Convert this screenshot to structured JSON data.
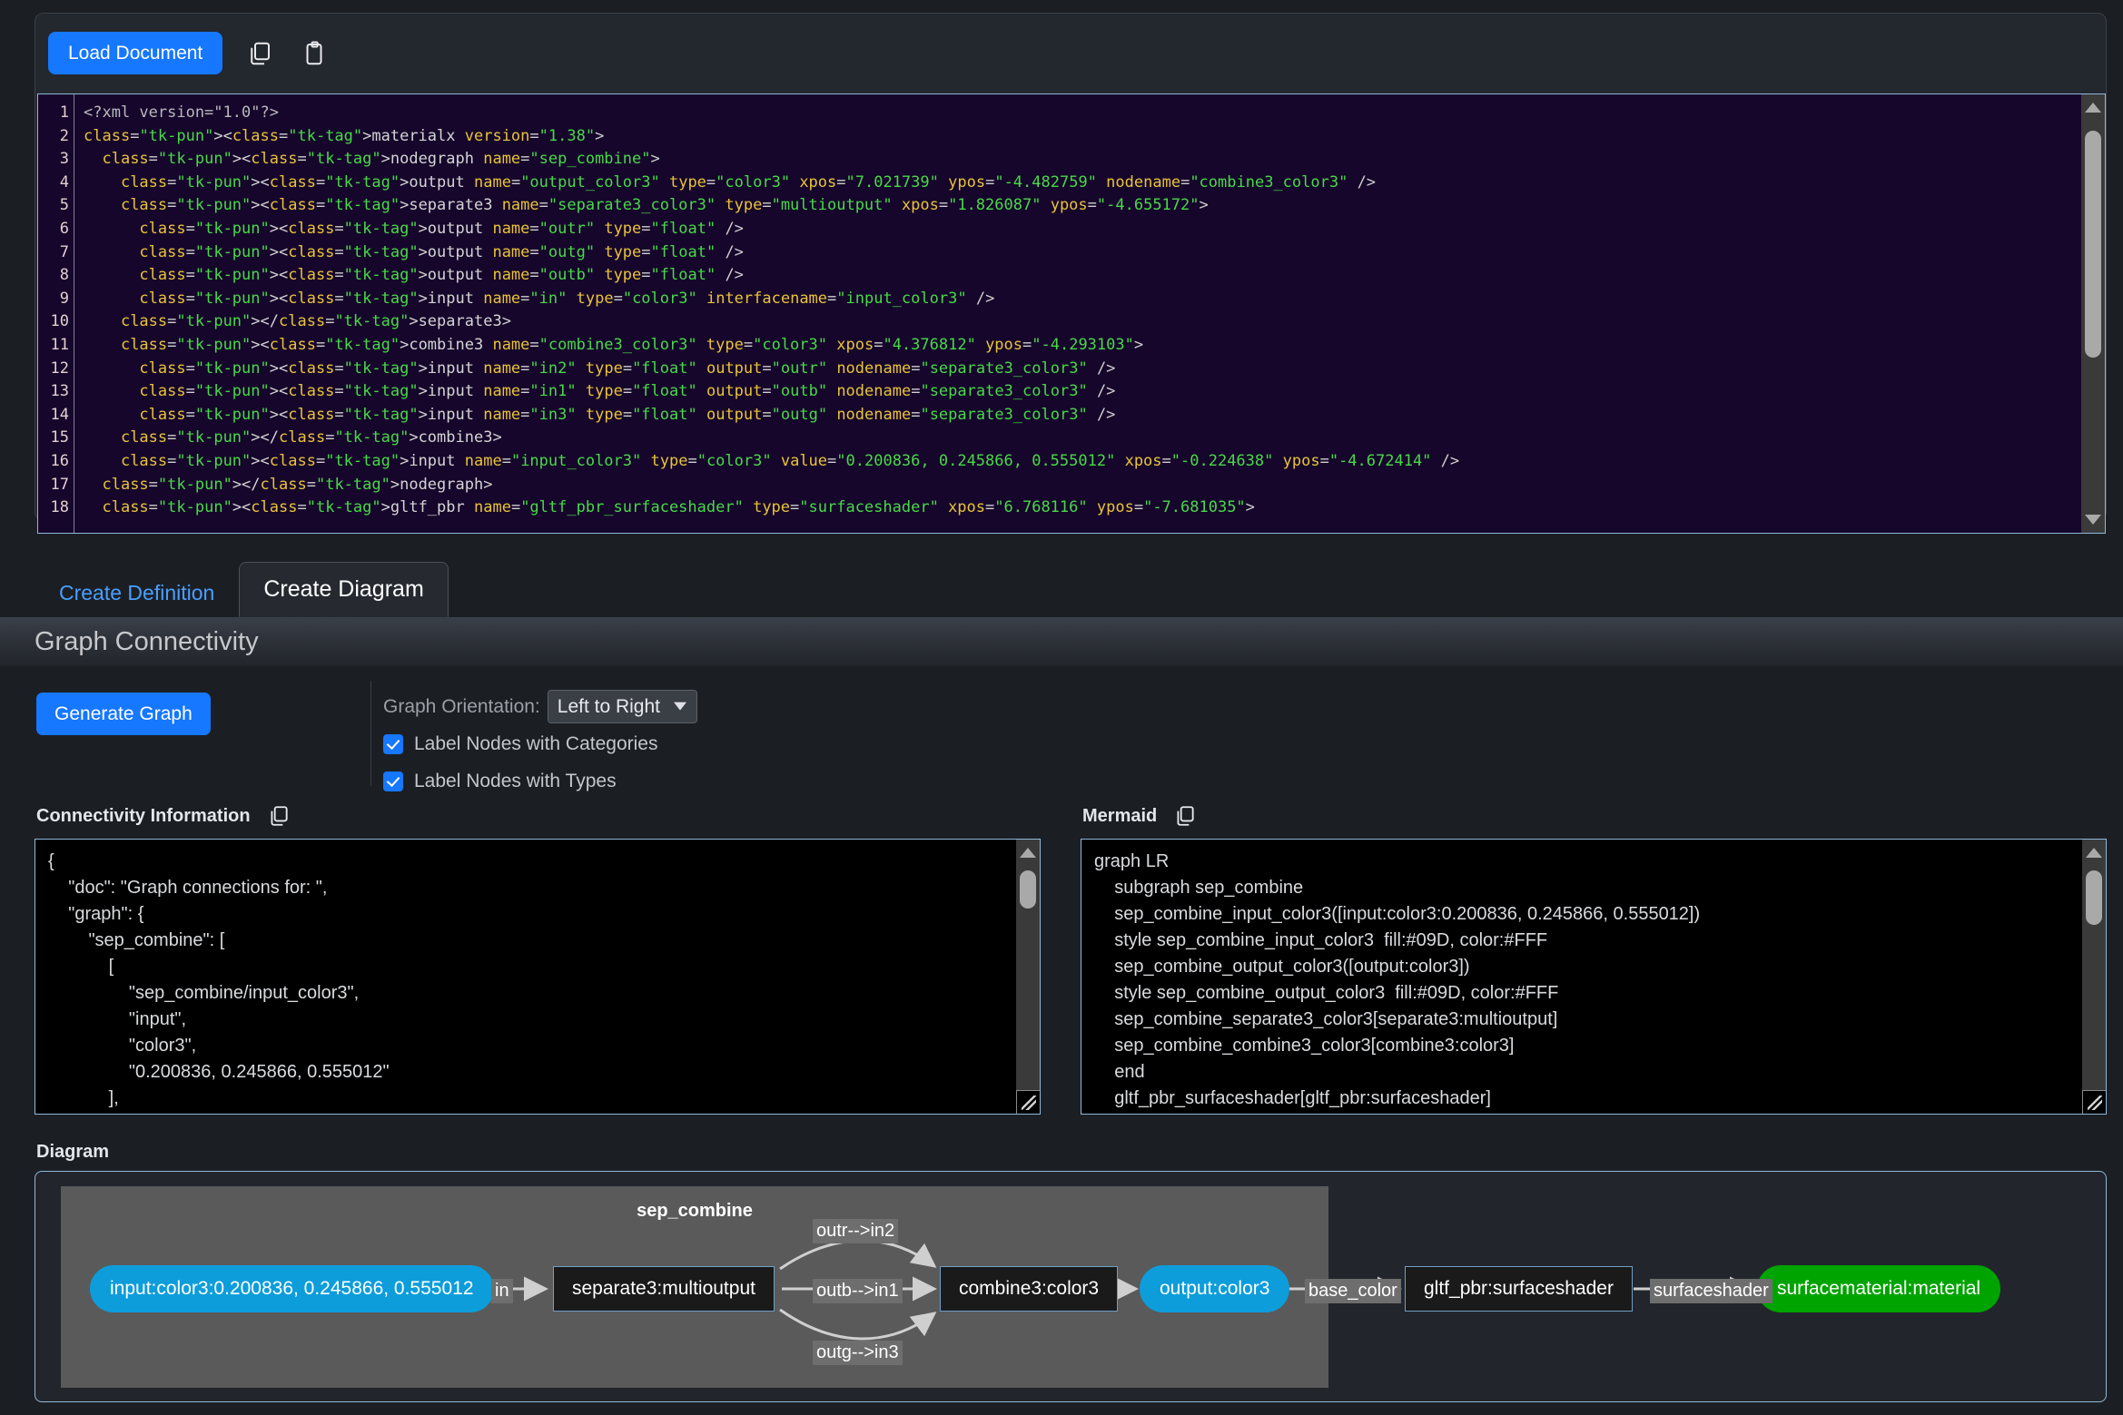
{
  "toolbar": {
    "load_document_label": "Load Document",
    "copy_icon": "copy-icon",
    "paste_icon": "paste-icon"
  },
  "editor": {
    "line_numbers": [
      1,
      2,
      3,
      4,
      5,
      6,
      7,
      8,
      9,
      10,
      11,
      12,
      13,
      14,
      15,
      16,
      17,
      18
    ],
    "lines": [
      "<?xml version=\"1.0\"?>",
      "<materialx version=\"1.38\">",
      "  <nodegraph name=\"sep_combine\">",
      "    <output name=\"output_color3\" type=\"color3\" xpos=\"7.021739\" ypos=\"-4.482759\" nodename=\"combine3_color3\" />",
      "    <separate3 name=\"separate3_color3\" type=\"multioutput\" xpos=\"1.826087\" ypos=\"-4.655172\">",
      "      <output name=\"outr\" type=\"float\" />",
      "      <output name=\"outg\" type=\"float\" />",
      "      <output name=\"outb\" type=\"float\" />",
      "      <input name=\"in\" type=\"color3\" interfacename=\"input_color3\" />",
      "    </separate3>",
      "    <combine3 name=\"combine3_color3\" type=\"color3\" xpos=\"4.376812\" ypos=\"-4.293103\">",
      "      <input name=\"in2\" type=\"float\" output=\"outr\" nodename=\"separate3_color3\" />",
      "      <input name=\"in1\" type=\"float\" output=\"outb\" nodename=\"separate3_color3\" />",
      "      <input name=\"in3\" type=\"float\" output=\"outg\" nodename=\"separate3_color3\" />",
      "    </combine3>",
      "    <input name=\"input_color3\" type=\"color3\" value=\"0.200836, 0.245866, 0.555012\" xpos=\"-0.224638\" ypos=\"-4.672414\" />",
      "  </nodegraph>",
      "  <gltf_pbr name=\"gltf_pbr_surfaceshader\" type=\"surfaceshader\" xpos=\"6.768116\" ypos=\"-7.681035\">"
    ]
  },
  "tabs": [
    {
      "label": "Create Definition",
      "active": false
    },
    {
      "label": "Create Diagram",
      "active": true
    }
  ],
  "section": {
    "title": "Graph Connectivity"
  },
  "controls": {
    "generate_graph_label": "Generate Graph",
    "orientation_label": "Graph Orientation:",
    "orientation_value": "Left to Right",
    "orientation_options": [
      "Left to Right"
    ],
    "checkbox_categories_label": "Label Nodes with Categories",
    "checkbox_categories_checked": true,
    "checkbox_types_label": "Label Nodes with Types",
    "checkbox_types_checked": true
  },
  "connectivity": {
    "label": "Connectivity Information",
    "copy_icon": "copy-icon",
    "text": "{\n    \"doc\": \"Graph connections for: \",\n    \"graph\": {\n        \"sep_combine\": [\n            [\n                \"sep_combine/input_color3\",\n                \"input\",\n                \"color3\",\n                \"0.200836, 0.245866, 0.555012\"\n            ],"
  },
  "mermaid": {
    "label": "Mermaid",
    "copy_icon": "copy-icon",
    "text": "graph LR\n    subgraph sep_combine\n    sep_combine_input_color3([input:color3:0.200836, 0.245866, 0.555012])\n    style sep_combine_input_color3  fill:#09D, color:#FFF\n    sep_combine_output_color3([output:color3])\n    style sep_combine_output_color3  fill:#09D, color:#FFF\n    sep_combine_separate3_color3[separate3:multioutput]\n    sep_combine_combine3_color3[combine3:color3]\n    end\n    gltf_pbr_surfaceshader[gltf_pbr:surfaceshader]"
  },
  "diagram": {
    "label": "Diagram",
    "subgraph_title": "sep_combine",
    "nodes": [
      {
        "id": "input",
        "label": "input:color3:0.200836, 0.245866, 0.555012",
        "shape": "rounded",
        "color": "#0d9ddb"
      },
      {
        "id": "separate3",
        "label": "separate3:multioutput",
        "shape": "rect",
        "color": "#1a1a1a"
      },
      {
        "id": "combine3",
        "label": "combine3:color3",
        "shape": "rect",
        "color": "#1a1a1a"
      },
      {
        "id": "output",
        "label": "output:color3",
        "shape": "rounded",
        "color": "#0d9ddb"
      },
      {
        "id": "gltf_pbr",
        "label": "gltf_pbr:surfaceshader",
        "shape": "rect",
        "color": "#1a1a1a"
      },
      {
        "id": "surfacematerial",
        "label": "surfacematerial:material",
        "shape": "rounded",
        "color": "#00a400"
      }
    ],
    "edges": [
      {
        "from": "input",
        "to": "separate3",
        "label": "in"
      },
      {
        "from": "separate3",
        "to": "combine3",
        "label": "outr-->in2"
      },
      {
        "from": "separate3",
        "to": "combine3",
        "label": "outb-->in1"
      },
      {
        "from": "separate3",
        "to": "combine3",
        "label": "outg-->in3"
      },
      {
        "from": "output",
        "to": "gltf_pbr",
        "label": "base_color"
      },
      {
        "from": "gltf_pbr",
        "to": "surfacematerial",
        "label": "surfaceshader"
      }
    ]
  }
}
